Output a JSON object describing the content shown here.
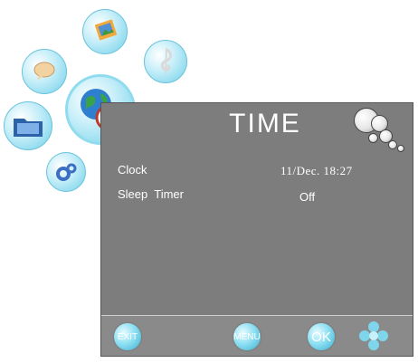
{
  "menu": {
    "title": "TIME",
    "items": [
      {
        "label": "Clock",
        "value": "11/Dec. 18:27"
      },
      {
        "label": "Sleep  Timer",
        "value": "Off"
      }
    ]
  },
  "footer": {
    "exit_label": "EXIT",
    "menu_label": "MENU",
    "ok_label": "OK"
  },
  "side_icons": [
    "picture-icon",
    "music-icon",
    "chat-icon",
    "time-globe-icon",
    "folder-icon",
    "gear-icon"
  ],
  "colors": {
    "panel": "#7d7d7d",
    "icon_accent": "#6fd0ea",
    "text": "#ffffff"
  }
}
